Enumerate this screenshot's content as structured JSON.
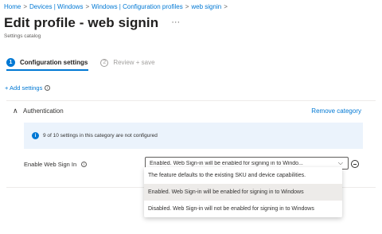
{
  "breadcrumb": [
    "Home",
    "Devices | Windows",
    "Windows | Configuration profiles",
    "web signin"
  ],
  "page": {
    "title": "Edit profile - web signin",
    "more": "···",
    "subtitle": "Settings catalog"
  },
  "steps": [
    {
      "number": "1",
      "label": "Configuration settings",
      "active": true
    },
    {
      "number": "2",
      "label": "Review + save",
      "active": false
    }
  ],
  "add_settings": "+ Add settings",
  "section": {
    "title": "Authentication",
    "remove_label": "Remove category",
    "banner_icon": "i",
    "banner_text": "9 of 10 settings in this category are not configured"
  },
  "setting": {
    "label": "Enable Web Sign In",
    "info_icon": "i",
    "value": "Enabled. Web Sign-in will be enabled for signing in to Windo...",
    "chevron": "⌵",
    "options": [
      "The feature defaults to the existing SKU and device capabilities.",
      "Enabled. Web Sign-in will be enabled for signing in to Windows",
      "Disabled. Web Sign-in will not be enabled for signing in to Windows"
    ],
    "selected_index": 1
  },
  "colors": {
    "accent": "#0078d4",
    "banner_bg": "#ebf3fc",
    "selected_option_bg": "#edebe9"
  }
}
